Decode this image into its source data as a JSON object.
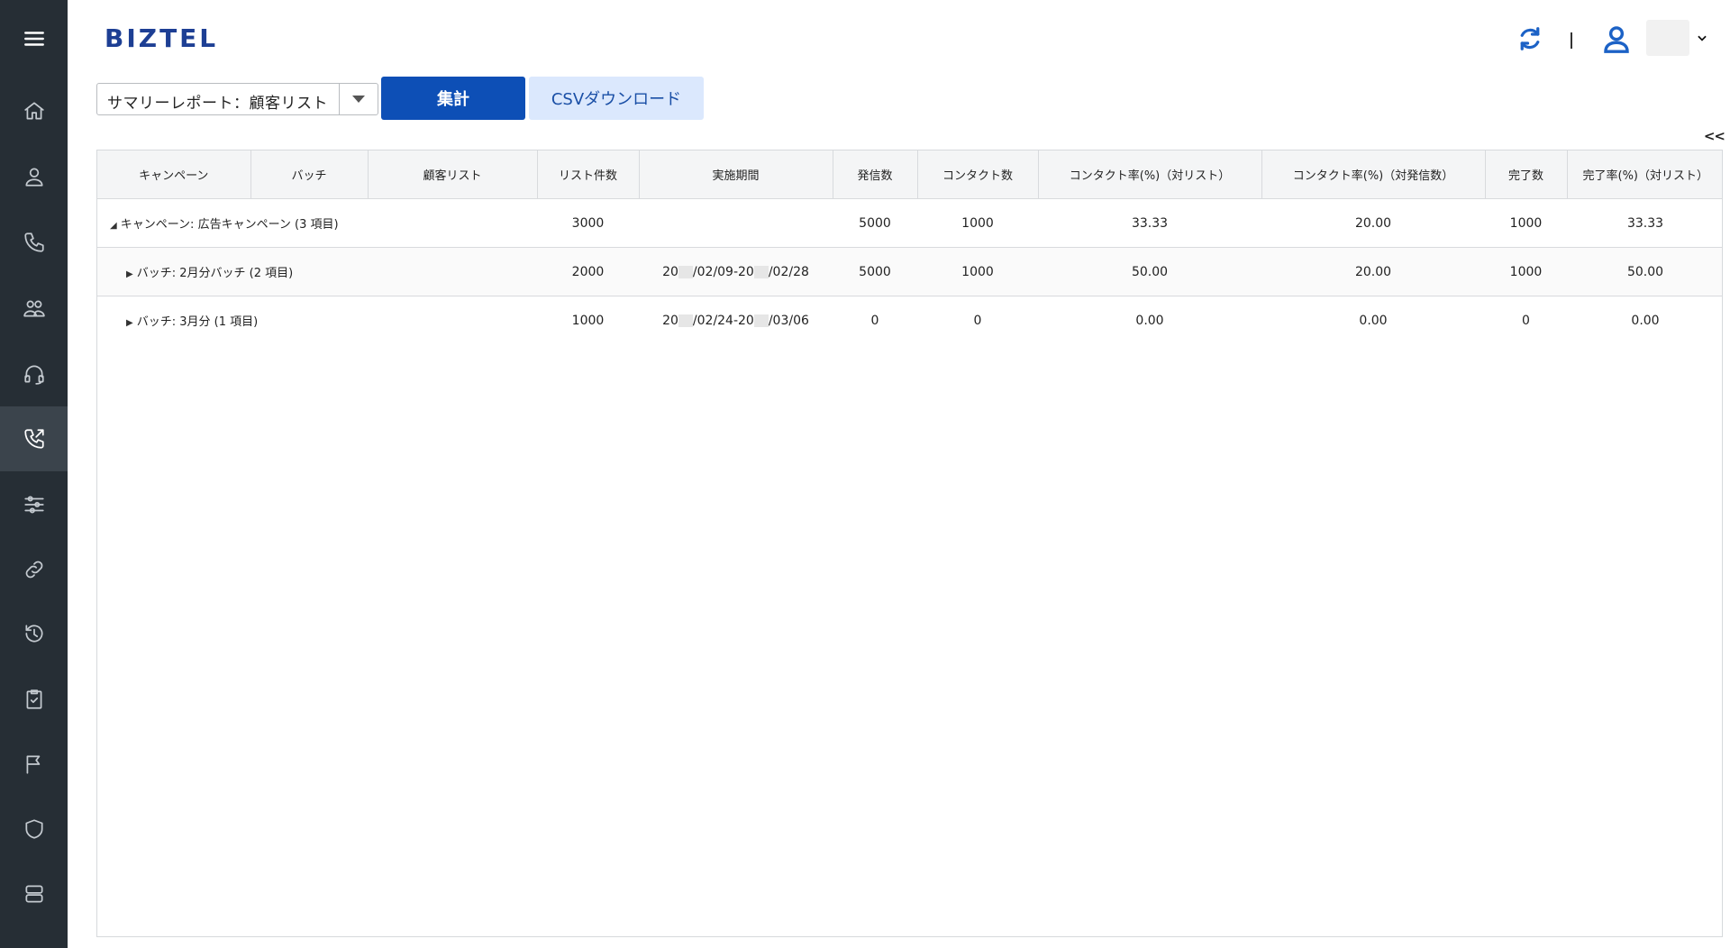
{
  "header": {
    "logo": "BIZTEL",
    "divider_char": "|"
  },
  "sidebar": {
    "items": [
      {
        "icon": "menu-icon"
      },
      {
        "icon": "home-icon"
      },
      {
        "icon": "user-icon"
      },
      {
        "icon": "phone-icon"
      },
      {
        "icon": "users-icon"
      },
      {
        "icon": "headset-icon"
      },
      {
        "icon": "outbound-call-icon",
        "active": true
      },
      {
        "icon": "sliders-icon"
      },
      {
        "icon": "link-icon"
      },
      {
        "icon": "history-icon"
      },
      {
        "icon": "checklist-icon"
      },
      {
        "icon": "flag-icon"
      },
      {
        "icon": "shield-icon"
      },
      {
        "icon": "server-icon"
      }
    ]
  },
  "toolbar": {
    "report_select": "サマリーレポート：顧客リスト",
    "aggregate_label": "集計",
    "csv_label": "CSVダウンロード",
    "collapse_label": "<<"
  },
  "table": {
    "columns": [
      "キャンペーン",
      "バッチ",
      "顧客リスト",
      "リスト件数",
      "実施期間",
      "発信数",
      "コンタクト数",
      "コンタクト率(%)（対リスト）",
      "コンタクト率(%)（対発信数）",
      "完了数",
      "完了率(%)（対リスト）"
    ],
    "rows": [
      {
        "label": "キャンペーン: 広告キャンペーン (3 項目)",
        "expander": "◢",
        "list_count": "3000",
        "period_a": "",
        "period_b": "",
        "period_c": "",
        "calls": "5000",
        "contacts": "1000",
        "contact_rate_list": "33.33",
        "contact_rate_calls": "20.00",
        "completed": "1000",
        "completion_rate": "33.33"
      },
      {
        "label": "バッチ: 2月分バッチ (2 項目)",
        "expander": "▶",
        "list_count": "2000",
        "period_a": "20",
        "period_b": "/02/09-20",
        "period_c": "/02/28",
        "calls": "5000",
        "contacts": "1000",
        "contact_rate_list": "50.00",
        "contact_rate_calls": "20.00",
        "completed": "1000",
        "completion_rate": "50.00"
      },
      {
        "label": "バッチ: 3月分 (1 項目)",
        "expander": "▶",
        "list_count": "1000",
        "period_a": "20",
        "period_b": "/02/24-20",
        "period_c": "/03/06",
        "calls": "0",
        "contacts": "0",
        "contact_rate_list": "0.00",
        "contact_rate_calls": "0.00",
        "completed": "0",
        "completion_rate": "0.00"
      }
    ]
  },
  "colors": {
    "sidebar_bg": "#262e35",
    "primary": "#0d4fb6",
    "secondary_bg": "#dbe8fd",
    "brand": "#1d3f94"
  }
}
